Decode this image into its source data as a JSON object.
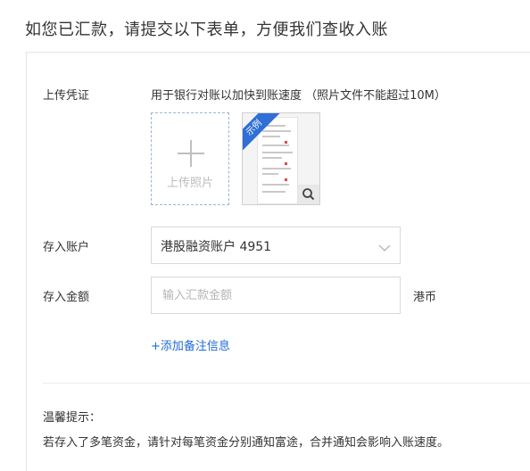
{
  "page": {
    "title": "如您已汇款，请提交以下表单，方便我们查收入账"
  },
  "form": {
    "upload": {
      "label": "上传凭证",
      "hint": "用于银行对账以加快到账速度 （照片文件不能超过10M）",
      "button_text": "上传照片",
      "sample_badge": "示例",
      "icons": [
        "plus-icon",
        "magnifier-icon"
      ]
    },
    "account": {
      "label": "存入账户",
      "selected": "港股融资账户 4951",
      "icon": "chevron-down-icon"
    },
    "amount": {
      "label": "存入金额",
      "placeholder": "输入汇款金额",
      "value": "",
      "unit": "港币"
    },
    "add_note_link": "+添加备注信息"
  },
  "tips": {
    "title": "温馨提示：",
    "text": "若存入了多笔资金，请针对每笔资金分别通知富途，合并通知会影响入账速度。"
  },
  "colors": {
    "link": "#1e6ad6",
    "badge": "#2f6fd6",
    "upload_border": "#9fb3d1"
  }
}
